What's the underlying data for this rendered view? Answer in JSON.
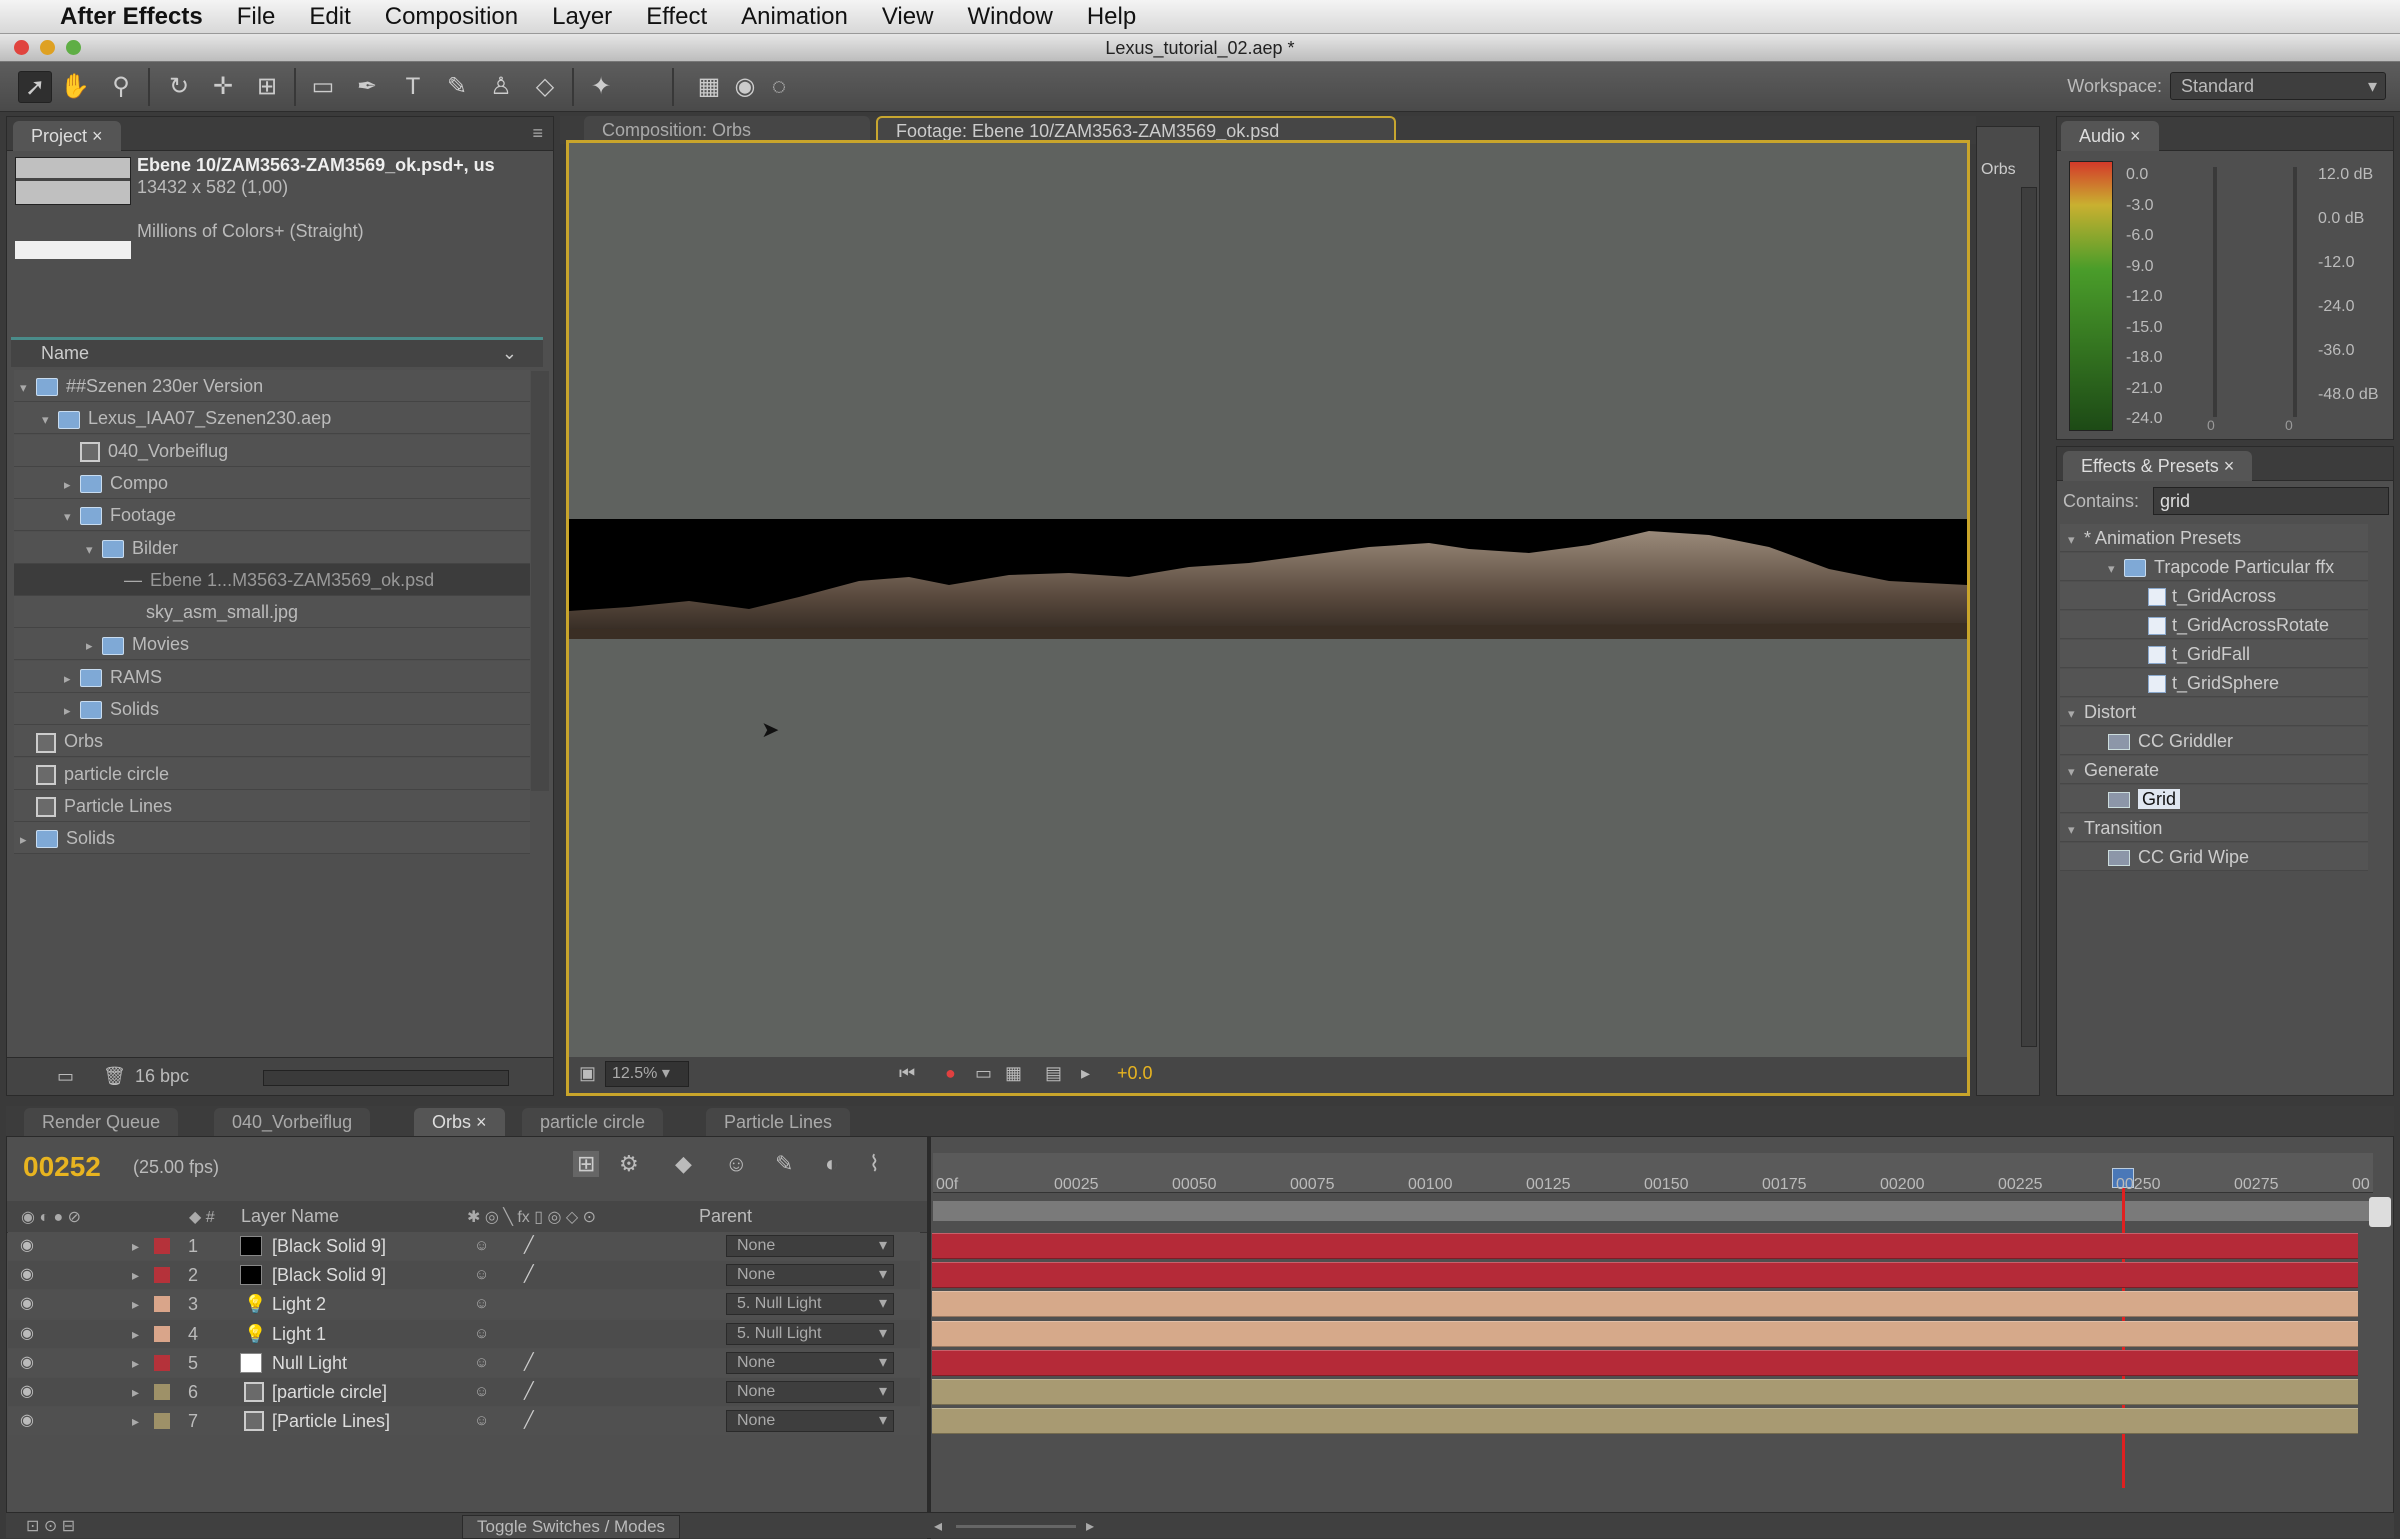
{
  "menubar": {
    "app_name": "After Effects",
    "items": [
      "File",
      "Edit",
      "Composition",
      "Layer",
      "Effect",
      "Animation",
      "View",
      "Window",
      "Help"
    ]
  },
  "window_title": "Lexus_tutorial_02.aep *",
  "toolbar": {
    "workspace_label": "Workspace:",
    "workspace_value": "Standard"
  },
  "project": {
    "tab_label": "Project",
    "footage_name": "Ebene 10/ZAM3563-ZAM3569_ok.psd+, us",
    "footage_dims": "13432 x 582 (1,00)",
    "footage_colors": "Millions of Colors+ (Straight)",
    "name_header": "Name",
    "items": [
      {
        "label": "##Szenen 230er Version",
        "indent": 0,
        "icon": "folder",
        "twirl": "▾"
      },
      {
        "label": "Lexus_IAA07_Szenen230.aep",
        "indent": 1,
        "icon": "folder",
        "twirl": "▾"
      },
      {
        "label": "040_Vorbeiflug",
        "indent": 2,
        "icon": "comp",
        "twirl": ""
      },
      {
        "label": "Compo",
        "indent": 2,
        "icon": "folder",
        "twirl": "▸"
      },
      {
        "label": "Footage",
        "indent": 2,
        "icon": "folder",
        "twirl": "▾"
      },
      {
        "label": "Bilder",
        "indent": 3,
        "icon": "folder",
        "twirl": "▾"
      },
      {
        "label": "Ebene 1...M3563-ZAM3569_ok.psd",
        "indent": 4,
        "icon": "footage",
        "twirl": "",
        "selected": true
      },
      {
        "label": "sky_asm_small.jpg",
        "indent": 4,
        "icon": "none",
        "twirl": ""
      },
      {
        "label": "Movies",
        "indent": 3,
        "icon": "folder",
        "twirl": "▸"
      },
      {
        "label": "RAMS",
        "indent": 2,
        "icon": "folder",
        "twirl": "▸"
      },
      {
        "label": "Solids",
        "indent": 2,
        "icon": "folder",
        "twirl": "▸"
      },
      {
        "label": "Orbs",
        "indent": 0,
        "icon": "comp",
        "twirl": ""
      },
      {
        "label": "particle circle",
        "indent": 0,
        "icon": "comp",
        "twirl": ""
      },
      {
        "label": "Particle Lines",
        "indent": 0,
        "icon": "comp",
        "twirl": ""
      },
      {
        "label": "Solids",
        "indent": 0,
        "icon": "folder",
        "twirl": "▸"
      }
    ],
    "bpc": "16 bpc"
  },
  "viewer": {
    "tab_comp": "Composition: Orbs",
    "tab_footage": "Footage: Ebene 10/ZAM3563-ZAM3569_ok.psd",
    "zoom": "12.5%",
    "exposure": "+0.0"
  },
  "orbs_side_tab": "Orbs",
  "audio": {
    "tab_label": "Audio",
    "left_levels": [
      "0.0",
      "-3.0",
      "-6.0",
      "-9.0",
      "-12.0",
      "-15.0",
      "-18.0",
      "-21.0",
      "-24.0"
    ],
    "right_levels": [
      "12.0 dB",
      "0.0 dB",
      "-12.0",
      "-24.0",
      "-36.0",
      "-48.0 dB"
    ],
    "slider_zero_a": "0",
    "slider_zero_b": "0"
  },
  "effects": {
    "tab_label": "Effects & Presets",
    "contains_label": "Contains:",
    "search_value": "grid",
    "rows": [
      {
        "label": "* Animation Presets",
        "indent": 0,
        "kind": "cat"
      },
      {
        "label": "Trapcode Particular ffx",
        "indent": 1,
        "kind": "folder"
      },
      {
        "label": "t_GridAcross",
        "indent": 2,
        "kind": "preset"
      },
      {
        "label": "t_GridAcrossRotate",
        "indent": 2,
        "kind": "preset"
      },
      {
        "label": "t_GridFall",
        "indent": 2,
        "kind": "preset"
      },
      {
        "label": "t_GridSphere",
        "indent": 2,
        "kind": "preset"
      },
      {
        "label": "Distort",
        "indent": 0,
        "kind": "cat"
      },
      {
        "label": "CC Griddler",
        "indent": 1,
        "kind": "effect"
      },
      {
        "label": "Generate",
        "indent": 0,
        "kind": "cat"
      },
      {
        "label": "Grid",
        "indent": 1,
        "kind": "effect",
        "selected": true
      },
      {
        "label": "Transition",
        "indent": 0,
        "kind": "cat"
      },
      {
        "label": "CC Grid Wipe",
        "indent": 1,
        "kind": "effect"
      }
    ]
  },
  "timeline": {
    "tabs": [
      "Render Queue",
      "040_Vorbeiflug",
      "Orbs",
      "particle circle",
      "Particle Lines"
    ],
    "timecode": "00252",
    "fps": "(25.00 fps)",
    "col_layer_name": "Layer Name",
    "col_parent": "Parent",
    "ruler_ticks": [
      "00f",
      "00025",
      "00050",
      "00075",
      "00100",
      "00125",
      "00150",
      "00175",
      "00200",
      "00225",
      "00250",
      "00275",
      "00"
    ],
    "layers": [
      {
        "num": "1",
        "name": "[Black Solid 9]",
        "parent": "None",
        "label_color": "#b5323a",
        "swatch": "#000000",
        "bar_color": "#b52a38"
      },
      {
        "num": "2",
        "name": "[Black Solid 9]",
        "parent": "None",
        "label_color": "#b5323a",
        "swatch": "#000000",
        "bar_color": "#b52a38"
      },
      {
        "num": "3",
        "name": "Light 2",
        "parent": "5. Null Light",
        "label_color": "#d9a58a",
        "swatch": "light",
        "bar_color": "#d6a98a"
      },
      {
        "num": "4",
        "name": "Light 1",
        "parent": "5. Null Light",
        "label_color": "#d9a58a",
        "swatch": "light",
        "bar_color": "#d6a98a"
      },
      {
        "num": "5",
        "name": "Null Light",
        "parent": "None",
        "label_color": "#b5323a",
        "swatch": "#ffffff",
        "bar_color": "#b52a38"
      },
      {
        "num": "6",
        "name": "[particle circle]",
        "parent": "None",
        "label_color": "#9e9168",
        "swatch": "comp",
        "bar_color": "#a89a72"
      },
      {
        "num": "7",
        "name": "[Particle Lines]",
        "parent": "None",
        "label_color": "#9e9168",
        "swatch": "comp",
        "bar_color": "#a89a72"
      }
    ],
    "toggle_label": "Toggle Switches / Modes"
  },
  "colors": {
    "panel_bg": "#4f4f4f",
    "viewer_border": "#c9a52b",
    "timecode": "#e8b420",
    "playhead": "#e02020"
  }
}
